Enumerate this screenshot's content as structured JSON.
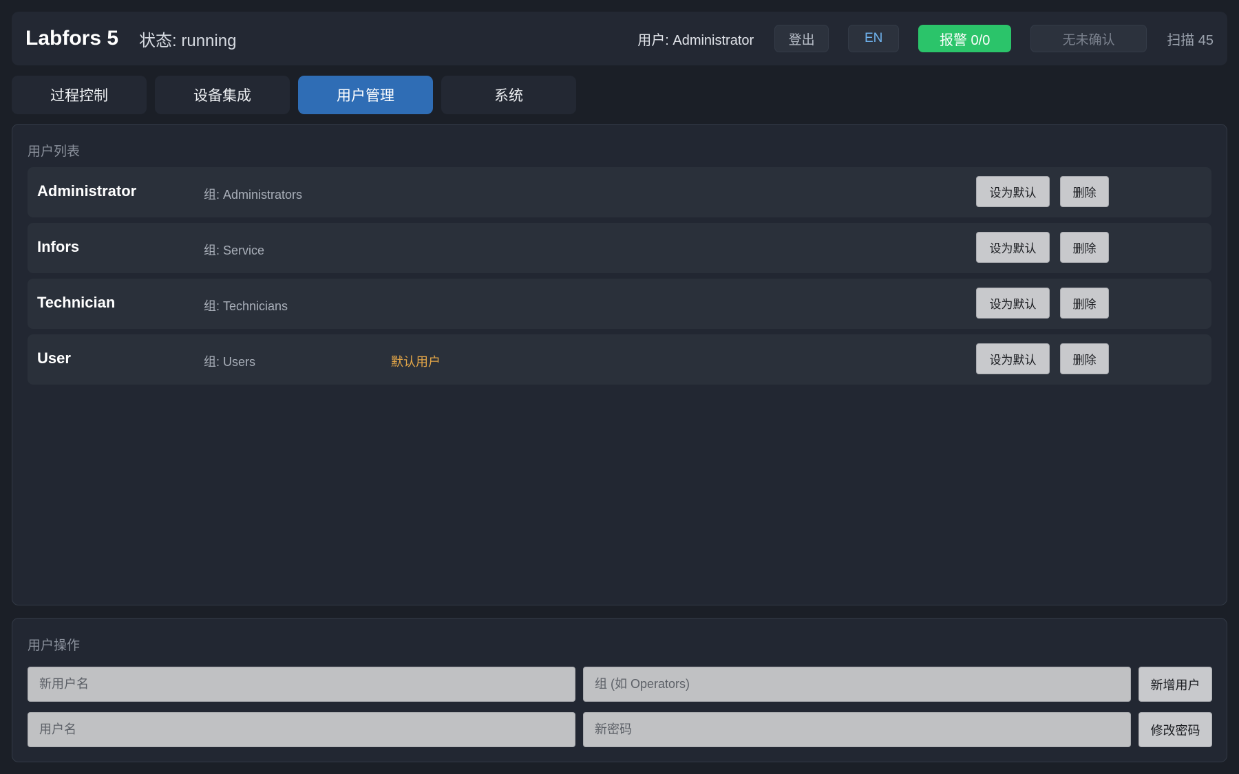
{
  "header": {
    "app_title": "Labfors 5",
    "status": "状态: running",
    "user_label": "用户: Administrator",
    "logout_label": "登出",
    "language_label": "EN",
    "alarm_label": "报警 0/0",
    "ack_label": "无未确认",
    "scan_label": "扫描 45"
  },
  "tabs": [
    {
      "label": "过程控制",
      "active": false
    },
    {
      "label": "设备集成",
      "active": false
    },
    {
      "label": "用户管理",
      "active": true
    },
    {
      "label": "系统",
      "active": false
    }
  ],
  "user_list": {
    "title": "用户列表",
    "set_default_label": "设为默认",
    "delete_label": "删除",
    "users": [
      {
        "name": "Administrator",
        "group": "组: Administrators",
        "badge": ""
      },
      {
        "name": "Infors",
        "group": "组: Service",
        "badge": ""
      },
      {
        "name": "Technician",
        "group": "组: Technicians",
        "badge": ""
      },
      {
        "name": "User",
        "group": "组: Users",
        "badge": "默认用户"
      }
    ]
  },
  "user_ops": {
    "title": "用户操作",
    "new_username_placeholder": "新用户名",
    "group_placeholder": "组 (如 Operators)",
    "add_user_label": "新增用户",
    "username_placeholder": "用户名",
    "new_password_placeholder": "新密码",
    "change_password_label": "修改密码"
  },
  "colors": {
    "background": "#1b1f27",
    "accent": "#2f6db5",
    "alarm_ok": "#2bc46a",
    "default_badge": "#e3a648"
  }
}
